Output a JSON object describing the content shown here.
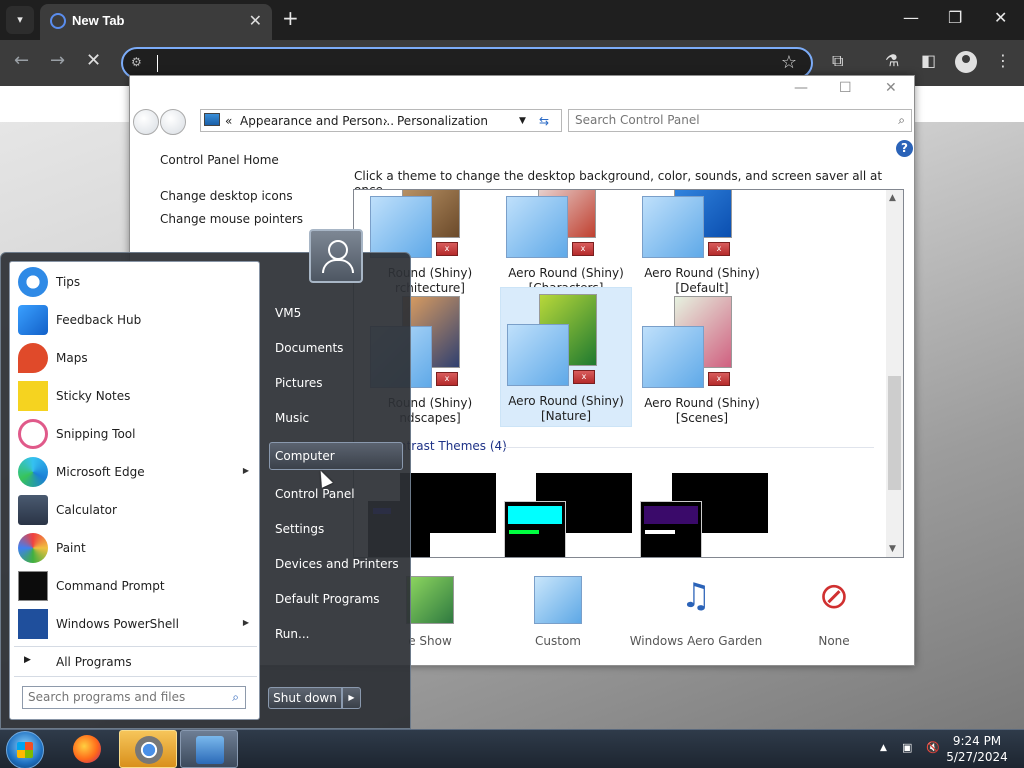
{
  "browser": {
    "tab_title": "New Tab",
    "address_value": "",
    "new_tab_symbol": "+"
  },
  "control_panel": {
    "breadcrumb": {
      "prefix": "«",
      "parent": "Appearance and Person...",
      "separator": "›",
      "current": "Personalization"
    },
    "search_placeholder": "Search Control Panel",
    "sidebar_links": [
      "Control Panel Home",
      "Change desktop icons",
      "Change mouse pointers"
    ],
    "description": "Click a theme to change the desktop background, color, sounds, and screen saver all at once.",
    "themes": [
      {
        "line1": "Round (Shiny)",
        "line2": "rchitecture]"
      },
      {
        "line1": "Aero Round (Shiny)",
        "line2": "[Characters]"
      },
      {
        "line1": "Aero Round (Shiny)",
        "line2": "[Default]"
      },
      {
        "line1": "Round (Shiny)",
        "line2": "ndscapes]"
      },
      {
        "line1": "Aero Round (Shiny)",
        "line2": "[Nature]"
      },
      {
        "line1": "Aero Round (Shiny)",
        "line2": "[Scenes]"
      }
    ],
    "high_contrast_header": "ntrast Themes (4)",
    "bottom_options": [
      "e Show",
      "Custom",
      "Windows Aero Garden",
      "None"
    ],
    "colors": {
      "link": "#1e3287",
      "selection": "#d9ebfb"
    }
  },
  "start_menu": {
    "apps": [
      {
        "label": "Tips",
        "icon": "tips-icon",
        "has_arrow": false
      },
      {
        "label": "Feedback Hub",
        "icon": "feedback-hub-icon",
        "has_arrow": false
      },
      {
        "label": "Maps",
        "icon": "maps-icon",
        "has_arrow": false
      },
      {
        "label": "Sticky Notes",
        "icon": "sticky-notes-icon",
        "has_arrow": false
      },
      {
        "label": "Snipping Tool",
        "icon": "snipping-tool-icon",
        "has_arrow": false
      },
      {
        "label": "Microsoft Edge",
        "icon": "edge-icon",
        "has_arrow": true
      },
      {
        "label": "Calculator",
        "icon": "calculator-icon",
        "has_arrow": false
      },
      {
        "label": "Paint",
        "icon": "paint-icon",
        "has_arrow": false
      },
      {
        "label": "Command Prompt",
        "icon": "command-prompt-icon",
        "has_arrow": false
      },
      {
        "label": "Windows PowerShell",
        "icon": "powershell-icon",
        "has_arrow": true
      }
    ],
    "all_programs": "All Programs",
    "search_placeholder": "Search programs and files",
    "places": [
      "VM5",
      "Documents",
      "Pictures",
      "Music",
      "Computer",
      "Control Panel",
      "Settings",
      "Devices and Printers",
      "Default Programs",
      "Run..."
    ],
    "highlighted_place": "Computer",
    "shutdown_label": "Shut down"
  },
  "taskbar": {
    "time": "9:24 PM",
    "date": "5/27/2024"
  }
}
